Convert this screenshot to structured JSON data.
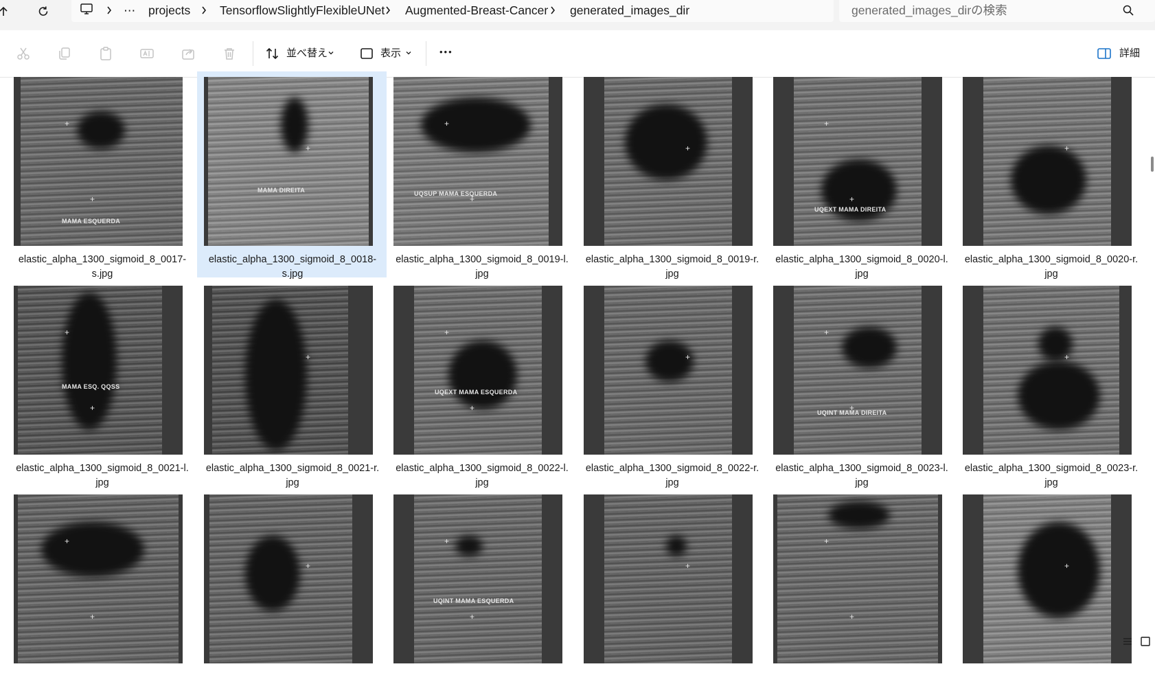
{
  "breadcrumb": {
    "overflow": "⋯",
    "items": [
      "projects",
      "TensorflowSlightlyFlexibleUNet",
      "Augmented-Breast-Cancer",
      "generated_images_dir"
    ]
  },
  "search": {
    "placeholder": "generated_images_dirの検索"
  },
  "toolbar": {
    "sort_label": "並べ替え",
    "view_label": "表示",
    "more_label": "•••",
    "details_label": "詳細"
  },
  "files": [
    {
      "name": "elastic_alpha_1300_sigmoid_8_0017-s.jpg",
      "thumb_label": "MAMA ESQUERDA",
      "selected": false
    },
    {
      "name": "elastic_alpha_1300_sigmoid_8_0018-s.jpg",
      "thumb_label": "MAMA DIREITA",
      "selected": true
    },
    {
      "name": "elastic_alpha_1300_sigmoid_8_0019-l.jpg",
      "thumb_label": "UQSUP MAMA ESQUERDA",
      "selected": false
    },
    {
      "name": "elastic_alpha_1300_sigmoid_8_0019-r.jpg",
      "thumb_label": "",
      "selected": false
    },
    {
      "name": "elastic_alpha_1300_sigmoid_8_0020-l.jpg",
      "thumb_label": "UQEXT MAMA DIREITA",
      "selected": false
    },
    {
      "name": "elastic_alpha_1300_sigmoid_8_0020-r.jpg",
      "thumb_label": "",
      "selected": false
    },
    {
      "name": "elastic_alpha_1300_sigmoid_8_0021-l.jpg",
      "thumb_label": "MAMA ESQ. QQSS",
      "selected": false
    },
    {
      "name": "elastic_alpha_1300_sigmoid_8_0021-r.jpg",
      "thumb_label": "",
      "selected": false
    },
    {
      "name": "elastic_alpha_1300_sigmoid_8_0022-l.jpg",
      "thumb_label": "UQEXT MAMA ESQUERDA",
      "selected": false
    },
    {
      "name": "elastic_alpha_1300_sigmoid_8_0022-r.jpg",
      "thumb_label": "",
      "selected": false
    },
    {
      "name": "elastic_alpha_1300_sigmoid_8_0023-l.jpg",
      "thumb_label": "UQINT MAMA DIREITA",
      "selected": false
    },
    {
      "name": "elastic_alpha_1300_sigmoid_8_0023-r.jpg",
      "thumb_label": "",
      "selected": false
    },
    {
      "name": "",
      "thumb_label": "",
      "selected": false
    },
    {
      "name": "",
      "thumb_label": "",
      "selected": false
    },
    {
      "name": "",
      "thumb_label": "UQINT MAMA ESQUERDA",
      "selected": false
    },
    {
      "name": "",
      "thumb_label": "",
      "selected": false
    },
    {
      "name": "",
      "thumb_label": "",
      "selected": false
    },
    {
      "name": "",
      "thumb_label": "",
      "selected": false
    }
  ],
  "colors": {
    "selection_bg": "#dcebfb",
    "chrome_bg": "#f3f3f3",
    "text": "#1a1a1a",
    "muted_icon": "#c4c4c4"
  }
}
